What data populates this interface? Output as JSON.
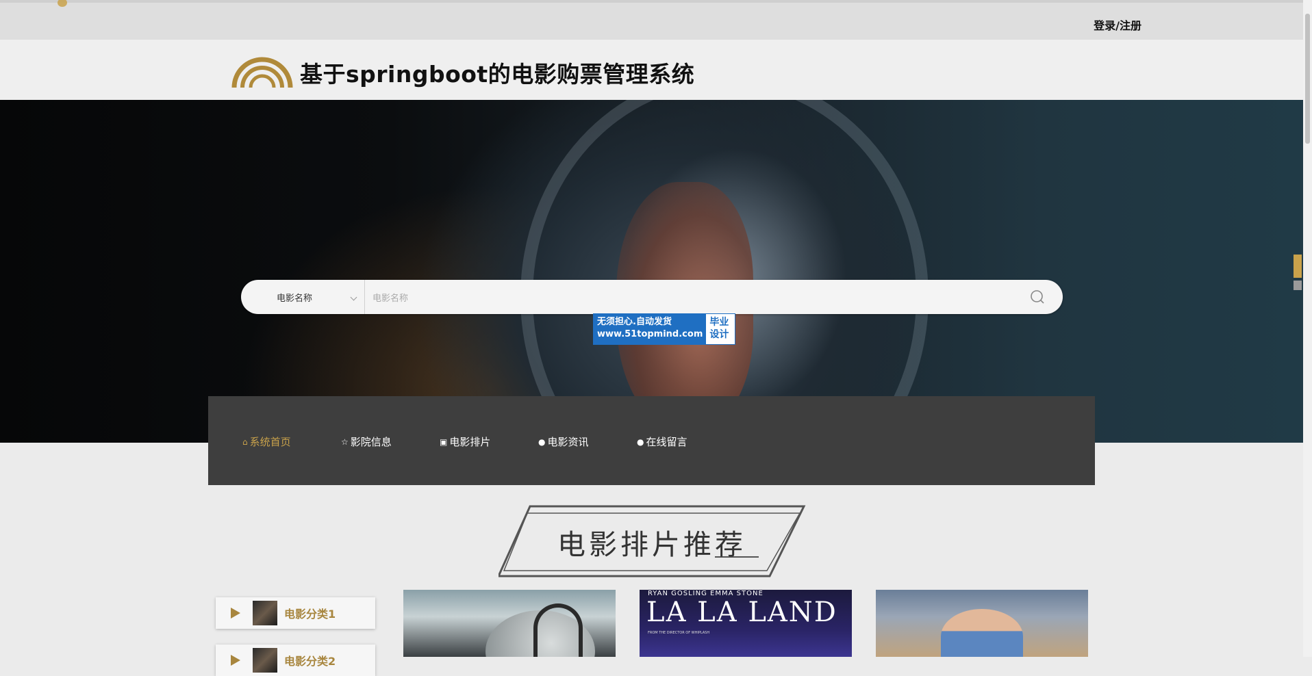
{
  "topbar": {
    "login_label": "登录/注册"
  },
  "header": {
    "site_title": "基于springboot的电影购票管理系统"
  },
  "search": {
    "select_value": "电影名称",
    "placeholder": "电影名称"
  },
  "watermark": {
    "line1": "无须担心.自动发货",
    "line2": "www.51topmind.com",
    "badge1": "毕业",
    "badge2": "设计"
  },
  "nav": {
    "items": [
      {
        "label": "系统首页",
        "icon": "home-icon",
        "active": true
      },
      {
        "label": "影院信息",
        "icon": "star-icon"
      },
      {
        "label": "电影排片",
        "icon": "bag-icon"
      },
      {
        "label": "电影资讯",
        "icon": "info-icon"
      },
      {
        "label": "在线留言",
        "icon": "question-icon"
      }
    ]
  },
  "section": {
    "title": "电影排片推荐"
  },
  "categories": [
    {
      "label": "电影分类1"
    },
    {
      "label": "电影分类2"
    }
  ],
  "posters": [
    {
      "alt": "poster-1"
    },
    {
      "actors": "RYAN GOSLING    EMMA STONE",
      "title": "LA LA LAND",
      "tagline": "FROM THE DIRECTOR OF WHIPLASH"
    },
    {
      "alt": "poster-3"
    }
  ],
  "colors": {
    "accent": "#c9a24b",
    "nav_bg": "#3e3e3e",
    "category_text": "#a8863e"
  }
}
